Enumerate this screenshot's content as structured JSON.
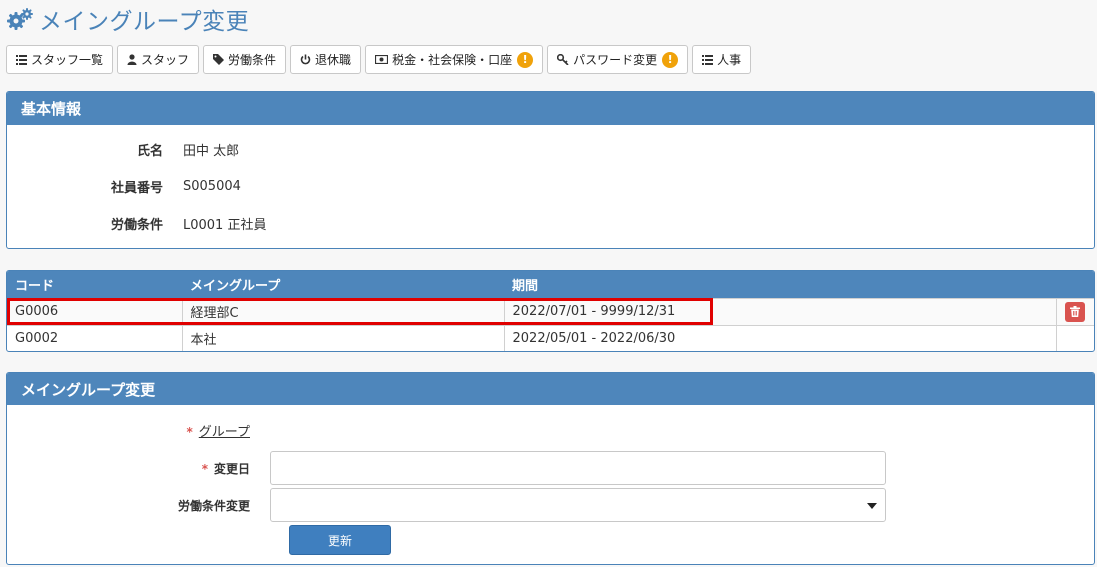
{
  "page": {
    "title": "メイングループ変更"
  },
  "toolbar": {
    "buttons": [
      {
        "label": "スタッフ一覧",
        "icon": "list-icon"
      },
      {
        "label": "スタッフ",
        "icon": "user-icon"
      },
      {
        "label": "労働条件",
        "icon": "tag-icon"
      },
      {
        "label": "退休職",
        "icon": "power-icon"
      },
      {
        "label": "税金・社会保険・口座",
        "icon": "money-icon",
        "warning": "!"
      },
      {
        "label": "パスワード変更",
        "icon": "key-icon",
        "warning": "!"
      },
      {
        "label": "人事",
        "icon": "list-icon"
      }
    ]
  },
  "basic_info": {
    "title": "基本情報",
    "fields": [
      {
        "label": "氏名",
        "value": "田中 太郎"
      },
      {
        "label": "社員番号",
        "value": "S005004"
      },
      {
        "label": "労働条件",
        "value": "L0001 正社員"
      }
    ]
  },
  "group_table": {
    "headers": [
      "コード",
      "メイングループ",
      "期間"
    ],
    "rows": [
      {
        "code": "G0006",
        "group": "経理部C",
        "period": "2022/07/01 - 9999/12/31",
        "deletable": true
      },
      {
        "code": "G0002",
        "group": "本社",
        "period": "2022/05/01 - 2022/06/30",
        "deletable": false
      }
    ]
  },
  "change_form": {
    "title": "メイングループ変更",
    "required_mark": "*",
    "group_label": "グループ",
    "date_label": "変更日",
    "date_value": "",
    "work_condition_label": "労働条件変更",
    "work_condition_value": "",
    "submit_label": "更新"
  },
  "colors": {
    "accent": "#4e86bb",
    "warning": "#f0a20a",
    "danger": "#d9534f",
    "highlight": "#e00000"
  }
}
